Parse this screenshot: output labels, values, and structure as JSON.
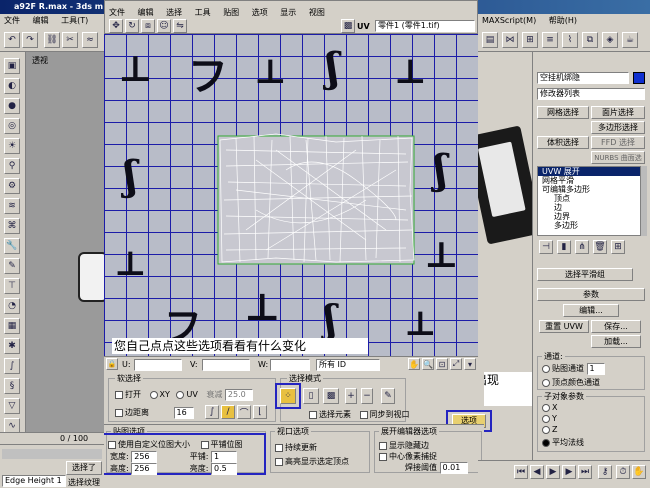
{
  "app": {
    "title": "a92F R.max - 3ds m",
    "uv_window_title": "UV"
  },
  "menu": {
    "file": "文件",
    "edit": "编辑",
    "tools": "工具(T)",
    "maxscript": "MAXScript(M)",
    "help": "帮助(H)"
  },
  "uv_menu": [
    "文件",
    "编辑",
    "选择",
    "工具",
    "贴图",
    "选项",
    "显示",
    "视图"
  ],
  "uv_toolbar": {
    "uv_label": "UV",
    "map_select": "零件1 (零件1.tif)"
  },
  "viewport": {
    "label": "透视"
  },
  "annotation_main": "您自己点点这些选项看看有什么变化",
  "annotation_options": "点这个按钮会出现\n选项窗口。。",
  "uv_bottom": {
    "u": "U:",
    "v": "V:",
    "w": "W:",
    "all_id": "所有 ID"
  },
  "soft_select": {
    "title": "软选择",
    "on": "打开",
    "xy": "XY",
    "uv": "UV",
    "falloff_label": "衰减",
    "falloff": "25.0",
    "edge_dist": "边距离",
    "edge_val": "16"
  },
  "select_mode": {
    "title": "选择模式",
    "select_elem": "选择元素",
    "sync_viewport": "同步到视口",
    "options_btn": "选项"
  },
  "map_options": {
    "title": "贴图选项",
    "custom_size": "使用自定义位图大小",
    "tile_bitmap": "平铺位图",
    "width_label": "宽度:",
    "width": "256",
    "height_label": "高度:",
    "height": "256",
    "tile_label": "平铺:",
    "tile": "1",
    "brightness_label": "亮度:",
    "brightness": "0.5"
  },
  "viewport_options": {
    "title": "视口选项",
    "constant_update": "持续更新",
    "show_hidden": "高亮显示选定顶点"
  },
  "editor_options": {
    "title": "展开编辑器选项",
    "show_hidden_edges": "显示隐藏边",
    "center_pixel": "中心像素捕捉",
    "weld_label": "焊接阈值",
    "weld": "0.01"
  },
  "right_panel": {
    "obj_name": "空挂机绑隐",
    "modifier_list": "修改器列表",
    "btns": [
      "网格选择",
      "面片选择",
      "多边形选择",
      "体积选择",
      "FFD 选择",
      "NURBS 曲面选择"
    ],
    "stack": [
      "UVW 展开",
      "网格平滑",
      "可编辑多边形",
      "顶点",
      "边",
      "边界",
      "多边形"
    ],
    "sel_rollout": "选择平滑组",
    "params": "参数",
    "edit_btn": "编辑...",
    "reset_uvw": "重置 UVW",
    "save": "保存...",
    "load": "加载...",
    "channel": "通道:",
    "map_channel": "贴图通道",
    "channel_val": "1",
    "vertex_color": "顶点颜色通道",
    "sub_obj": "子对象参数",
    "xyz": [
      "X",
      "Y",
      "Z"
    ],
    "average": "平均法线"
  },
  "status": {
    "frame": "0 / 100",
    "selected": "选择了",
    "prompt": "Edge Height 1",
    "hint": "选择纹理"
  }
}
